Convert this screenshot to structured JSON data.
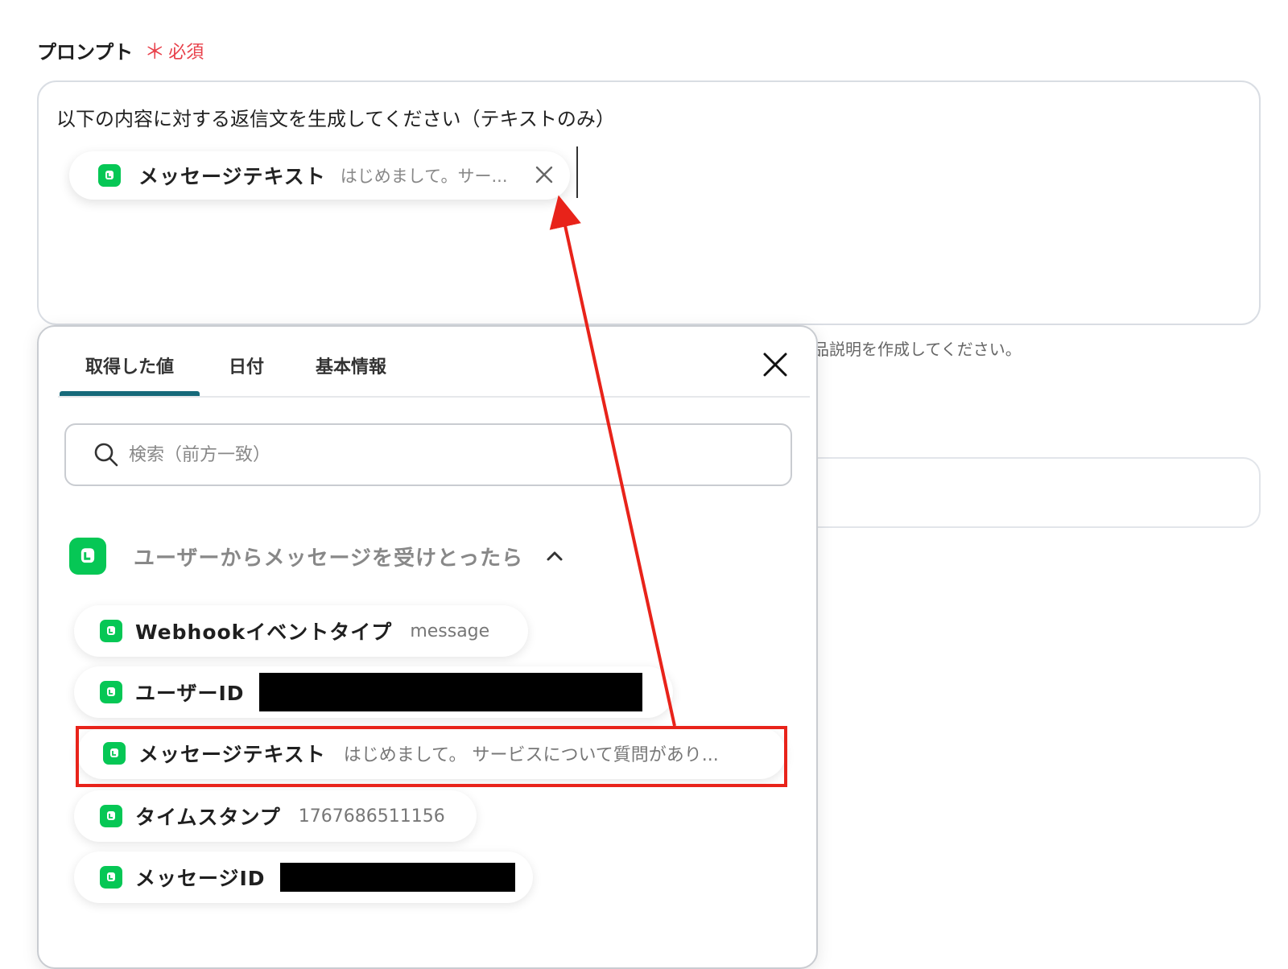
{
  "field": {
    "label": "プロンプト",
    "required_mark": "＊",
    "required_text": "必須"
  },
  "prompt": {
    "text": "以下の内容に対する返信文を生成してください（テキストのみ）",
    "chip": {
      "icon": "line-icon",
      "name": "メッセージテキスト",
      "value": "はじめまして。サー..."
    }
  },
  "hint_text": "品説明を作成してください。",
  "popup": {
    "tabs": [
      {
        "label": "取得した値",
        "active": true
      },
      {
        "label": "日付",
        "active": false
      },
      {
        "label": "基本情報",
        "active": false
      }
    ],
    "search_placeholder": "検索（前方一致）",
    "group": {
      "icon": "line-icon",
      "title": "ユーザーからメッセージを受けとったら",
      "expanded": true
    },
    "items": [
      {
        "name": "Webhookイベントタイプ",
        "value": "message"
      },
      {
        "name": "ユーザーID",
        "value": ""
      },
      {
        "name": "メッセージテキスト",
        "value": "はじめまして。 サービスについて質問があり..."
      },
      {
        "name": "タイムスタンプ",
        "value": "1767686511156"
      },
      {
        "name": "メッセージID",
        "value": ""
      }
    ]
  },
  "colors": {
    "required": "#e8404a",
    "line_green": "#06c755",
    "active_tab": "#166a7a",
    "annotation": "#e8231a"
  }
}
